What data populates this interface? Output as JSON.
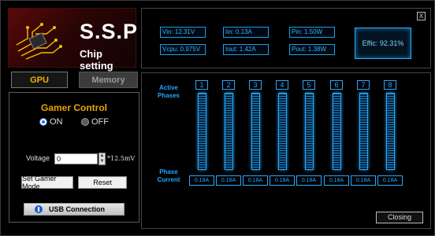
{
  "logo": {
    "title": "S.S.P",
    "subtitle": "Chip setting"
  },
  "tabs": {
    "gpu": "GPU",
    "memory": "Memory"
  },
  "gamer": {
    "title": "Gamer Control",
    "on_label": "ON",
    "off_label": "OFF",
    "selected": "ON",
    "voltage_label": "Voltage",
    "voltage_value": "0",
    "step_label": "*12.5mV",
    "set_button": "Set Gamer Mode",
    "reset_button": "Reset",
    "usb_button": "USB Connection"
  },
  "metrics": {
    "vin": "Vin: 12.31V",
    "iin": "Iin: 0.13A",
    "pin": "Pin: 1.50W",
    "vcpu": "Vcpu: 0.975V",
    "iout": "Iout: 1.42A",
    "pout": "Pout: 1.38W",
    "effic": "Effic: 92.31%"
  },
  "phases": {
    "active_label": "Active Phases",
    "current_label": "Phase Current",
    "numbers": [
      "1",
      "2",
      "3",
      "4",
      "5",
      "6",
      "7",
      "8"
    ],
    "currents": [
      "0.18A",
      "0.18A",
      "0.18A",
      "0.18A",
      "0.18A",
      "0.18A",
      "0.18A",
      "0.18A"
    ]
  },
  "footer": {
    "closing": "Closing"
  },
  "close_glyph": "X",
  "colors": {
    "accent_blue": "#2aa9ff",
    "gamer_orange": "#e8a400",
    "logo_red": "#5a0a0a"
  }
}
